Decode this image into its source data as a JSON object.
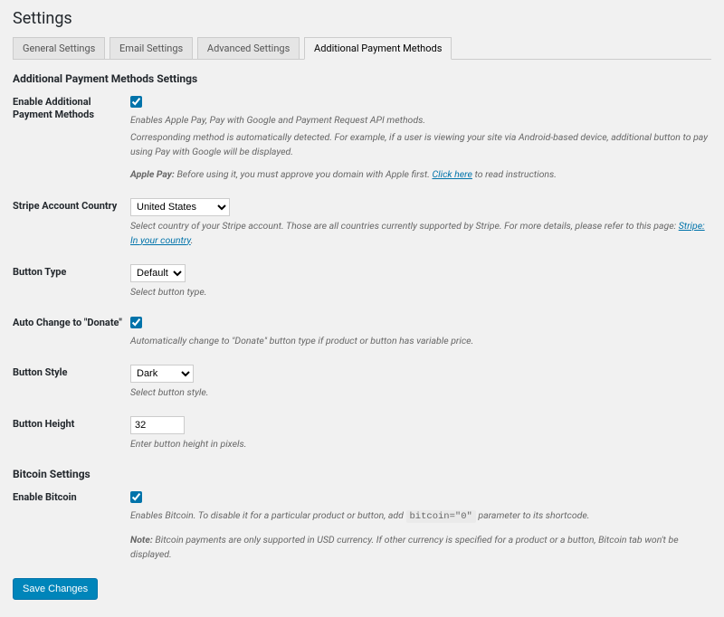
{
  "page": {
    "title": "Settings"
  },
  "tabs": {
    "general": "General Settings",
    "email": "Email Settings",
    "advanced": "Advanced Settings",
    "additional": "Additional Payment Methods"
  },
  "sections": {
    "apm_heading": "Additional Payment Methods Settings",
    "bitcoin_heading": "Bitcoin Settings"
  },
  "fields": {
    "enable_apm": {
      "label": "Enable Additional Payment Methods",
      "desc1": "Enables Apple Pay, Pay with Google and Payment Request API methods.",
      "desc2": "Corresponding method is automatically detected. For example, if a user is viewing your site via Android-based device, additional button to pay using Pay with Google will be displayed.",
      "desc3_strong": "Apple Pay:",
      "desc3_a": " Before using it, you must approve you domain with Apple first. ",
      "desc3_link": "Click here",
      "desc3_b": " to read instructions."
    },
    "country": {
      "label": "Stripe Account Country",
      "value": "United States",
      "desc_a": "Select country of your Stripe account. Those are all countries currently supported by Stripe. For more details, please refer to this page: ",
      "desc_link": "Stripe: In your country",
      "desc_b": "."
    },
    "button_type": {
      "label": "Button Type",
      "value": "Default",
      "desc": "Select button type."
    },
    "auto_change": {
      "label": "Auto Change to \"Donate\"",
      "desc": "Automatically change to \"Donate\" button type if product or button has variable price."
    },
    "button_style": {
      "label": "Button Style",
      "value": "Dark",
      "desc": "Select button style."
    },
    "button_height": {
      "label": "Button Height",
      "value": "32",
      "desc": "Enter button height in pixels."
    },
    "enable_bitcoin": {
      "label": "Enable Bitcoin",
      "desc1_a": "Enables Bitcoin. To disable it for a particular product or button, add ",
      "desc1_code": "bitcoin=\"0\"",
      "desc1_b": " parameter to its shortcode.",
      "desc2_strong": "Note:",
      "desc2": " Bitcoin payments are only supported in USD currency. If other currency is specified for a product or a button, Bitcoin tab won't be displayed."
    }
  },
  "actions": {
    "save": "Save Changes"
  }
}
